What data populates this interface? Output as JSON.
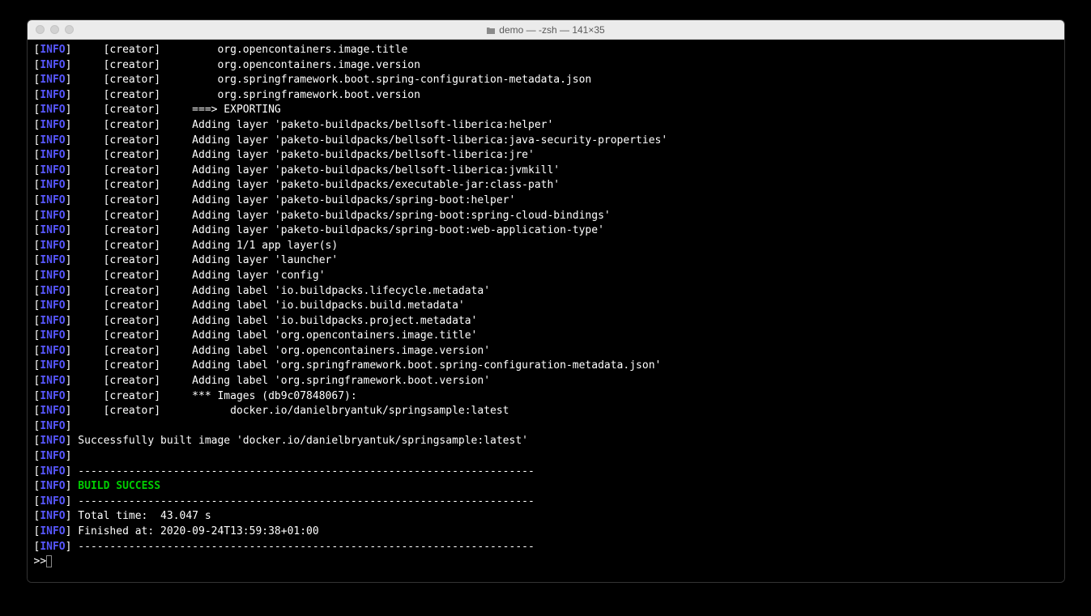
{
  "window": {
    "title": "demo — -zsh — 141×35"
  },
  "lines": [
    {
      "type": "creator",
      "text": "        org.opencontainers.image.title"
    },
    {
      "type": "creator",
      "text": "        org.opencontainers.image.version"
    },
    {
      "type": "creator",
      "text": "        org.springframework.boot.spring-configuration-metadata.json"
    },
    {
      "type": "creator",
      "text": "        org.springframework.boot.version"
    },
    {
      "type": "creator",
      "text": "    ===> EXPORTING"
    },
    {
      "type": "creator",
      "text": "    Adding layer 'paketo-buildpacks/bellsoft-liberica:helper'"
    },
    {
      "type": "creator",
      "text": "    Adding layer 'paketo-buildpacks/bellsoft-liberica:java-security-properties'"
    },
    {
      "type": "creator",
      "text": "    Adding layer 'paketo-buildpacks/bellsoft-liberica:jre'"
    },
    {
      "type": "creator",
      "text": "    Adding layer 'paketo-buildpacks/bellsoft-liberica:jvmkill'"
    },
    {
      "type": "creator",
      "text": "    Adding layer 'paketo-buildpacks/executable-jar:class-path'"
    },
    {
      "type": "creator",
      "text": "    Adding layer 'paketo-buildpacks/spring-boot:helper'"
    },
    {
      "type": "creator",
      "text": "    Adding layer 'paketo-buildpacks/spring-boot:spring-cloud-bindings'"
    },
    {
      "type": "creator",
      "text": "    Adding layer 'paketo-buildpacks/spring-boot:web-application-type'"
    },
    {
      "type": "creator",
      "text": "    Adding 1/1 app layer(s)"
    },
    {
      "type": "creator",
      "text": "    Adding layer 'launcher'"
    },
    {
      "type": "creator",
      "text": "    Adding layer 'config'"
    },
    {
      "type": "creator",
      "text": "    Adding label 'io.buildpacks.lifecycle.metadata'"
    },
    {
      "type": "creator",
      "text": "    Adding label 'io.buildpacks.build.metadata'"
    },
    {
      "type": "creator",
      "text": "    Adding label 'io.buildpacks.project.metadata'"
    },
    {
      "type": "creator",
      "text": "    Adding label 'org.opencontainers.image.title'"
    },
    {
      "type": "creator",
      "text": "    Adding label 'org.opencontainers.image.version'"
    },
    {
      "type": "creator",
      "text": "    Adding label 'org.springframework.boot.spring-configuration-metadata.json'"
    },
    {
      "type": "creator",
      "text": "    Adding label 'org.springframework.boot.version'"
    },
    {
      "type": "creator",
      "text": "    *** Images (db9c07848067):"
    },
    {
      "type": "creator",
      "text": "          docker.io/danielbryantuk/springsample:latest"
    },
    {
      "type": "info",
      "text": ""
    },
    {
      "type": "info",
      "text": " Successfully built image 'docker.io/danielbryantuk/springsample:latest'"
    },
    {
      "type": "info",
      "text": ""
    },
    {
      "type": "info",
      "text": " ------------------------------------------------------------------------"
    },
    {
      "type": "success",
      "text": " BUILD SUCCESS"
    },
    {
      "type": "info",
      "text": " ------------------------------------------------------------------------"
    },
    {
      "type": "info",
      "text": " Total time:  43.047 s"
    },
    {
      "type": "info",
      "text": " Finished at: 2020-09-24T13:59:38+01:00"
    },
    {
      "type": "info",
      "text": " ------------------------------------------------------------------------"
    }
  ],
  "labels": {
    "info_tag": "INFO",
    "creator_tag": "[creator]",
    "prompt": ">>"
  }
}
